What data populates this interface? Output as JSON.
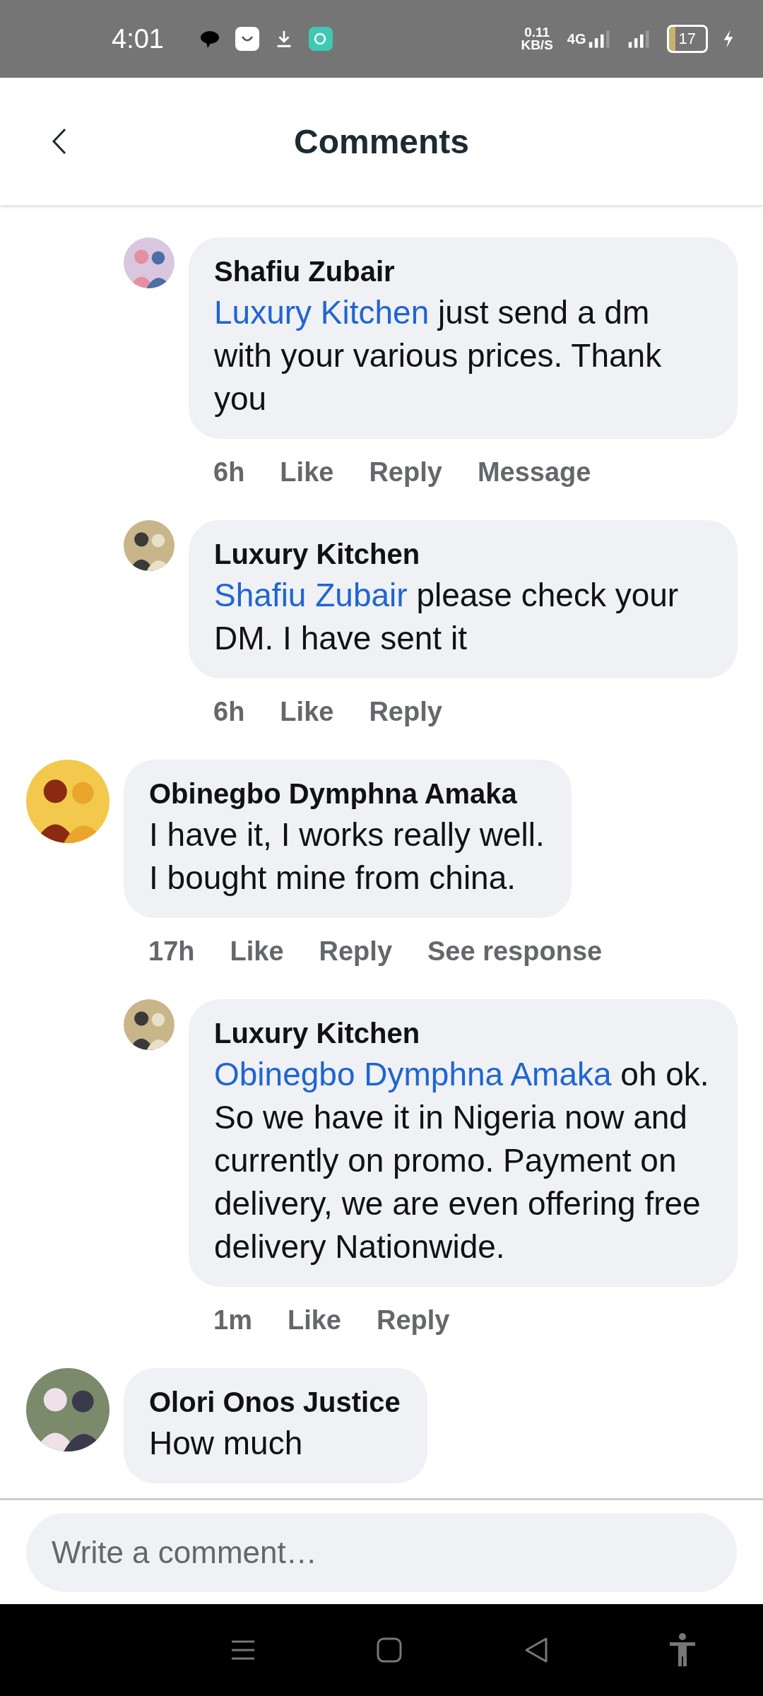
{
  "status_bar": {
    "time": "4:01",
    "net_speed": "0.11",
    "net_unit": "KB/S",
    "network": "4G",
    "battery": "17"
  },
  "header": {
    "title": "Comments"
  },
  "comments": [
    {
      "kind": "reply",
      "name": "Shafiu Zubair",
      "mention": "Luxury Kitchen",
      "text": " just send a dm with your various prices. Thank you",
      "time": "6h",
      "actions": [
        "Like",
        "Reply",
        "Message"
      ]
    },
    {
      "kind": "reply",
      "name": "Luxury Kitchen",
      "mention": "Shafiu Zubair",
      "text": " please check your DM. I have sent it",
      "time": "6h",
      "actions": [
        "Like",
        "Reply"
      ]
    },
    {
      "kind": "top",
      "name": "Obinegbo Dymphna Amaka",
      "text": "I have it, I works really well.\nI bought mine from china.",
      "time": "17h",
      "actions": [
        "Like",
        "Reply",
        "See response"
      ]
    },
    {
      "kind": "reply",
      "name": "Luxury Kitchen",
      "mention": "Obinegbo Dymphna Amaka",
      "text": " oh ok.\nSo we have it in Nigeria now and currently on promo. Payment on delivery, we are even offering free delivery Nationwide.",
      "time": "1m",
      "actions": [
        "Like",
        "Reply"
      ]
    },
    {
      "kind": "top",
      "name": "Olori Onos Justice",
      "text": "How much"
    }
  ],
  "composer": {
    "placeholder": "Write a comment…"
  }
}
